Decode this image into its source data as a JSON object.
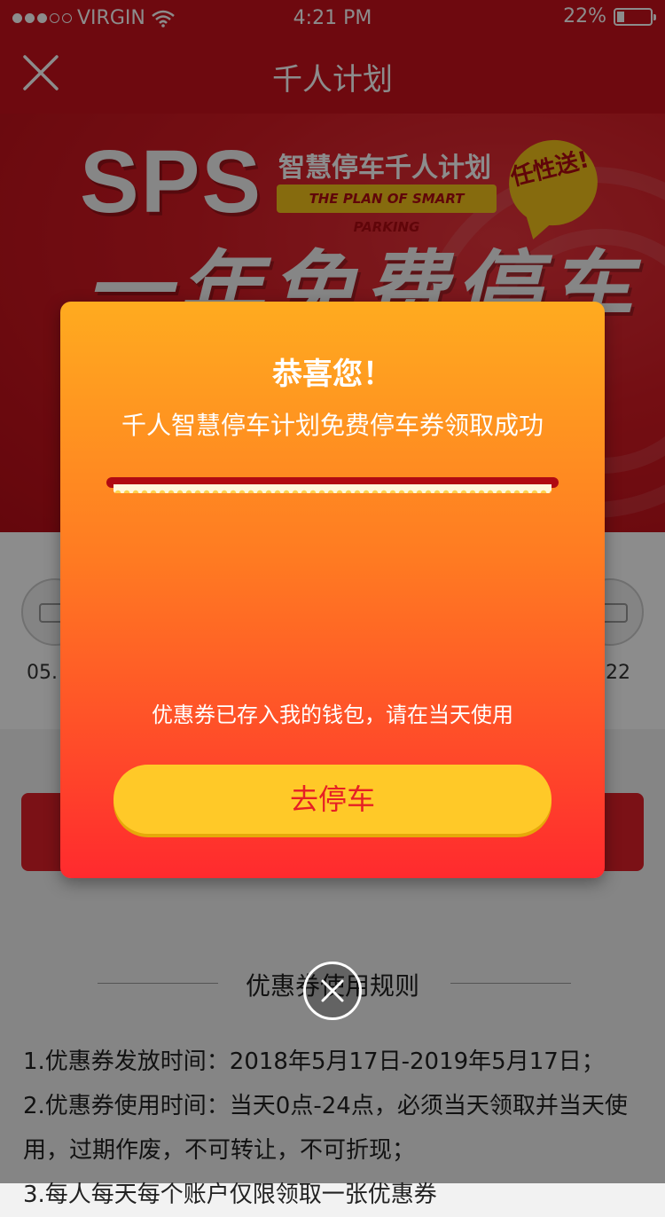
{
  "status_bar": {
    "carrier": "VIRGIN",
    "time": "4:21 PM",
    "battery": "22%",
    "battery_level": 0.22
  },
  "nav": {
    "title": "千人计划",
    "close_icon": "close-icon"
  },
  "banner": {
    "brand": "SPS",
    "subtitle": "智慧停车千人计划",
    "english_tag": "THE PLAN OF SMART PARKING",
    "bubble_text": "任性送!",
    "headline": "一年免费停车"
  },
  "coupon_row": {
    "left_date": "05.",
    "right_date": ".22"
  },
  "rules": {
    "title": "优惠券使用规则",
    "items": [
      "1.优惠券发放时间：2018年5月17日-2019年5月17日；",
      "2.优惠券使用时间：当天0点-24点，必须当天领取并当天使用，过期作废，不可转让，不可折现；",
      "3.每人每天每个账户仅限领取一张优惠券"
    ]
  },
  "dialog": {
    "title": "恭喜您！",
    "subtitle": "千人智慧停车计划免费停车券领取成功",
    "note": "优惠券已存入我的钱包，请在当天使用",
    "button_label": "去停车",
    "close_icon": "close-icon"
  },
  "colors": {
    "brand_red": "#c8121c",
    "dialog_top": "#ffab1f",
    "dialog_bottom": "#ff2a2e",
    "button_yellow": "#ffc928",
    "button_text": "#e61f25"
  }
}
